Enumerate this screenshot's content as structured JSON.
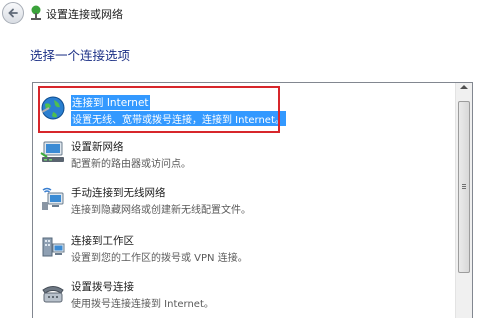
{
  "header": {
    "title": "设置连接或网络"
  },
  "section_title": "选择一个连接选项",
  "options": [
    {
      "title": "连接到 Internet",
      "description": "设置无线、宽带或拨号连接，连接到 Internet。",
      "icon": "globe-icon",
      "selected": true
    },
    {
      "title": "设置新网络",
      "description": "配置新的路由器或访问点。",
      "icon": "router-icon",
      "selected": false
    },
    {
      "title": "手动连接到无线网络",
      "description": "连接到隐藏网络或创建新无线配置文件。",
      "icon": "wireless-computer-icon",
      "selected": false
    },
    {
      "title": "连接到工作区",
      "description": "设置到您的工作区的拨号或 VPN 连接。",
      "icon": "workplace-icon",
      "selected": false
    },
    {
      "title": "设置拨号连接",
      "description": "使用拨号连接连接到 Internet。",
      "icon": "phone-icon",
      "selected": false
    }
  ],
  "colors": {
    "selection": "#3399ff",
    "highlight_border": "#d7262b",
    "section_title": "#1e3287"
  }
}
